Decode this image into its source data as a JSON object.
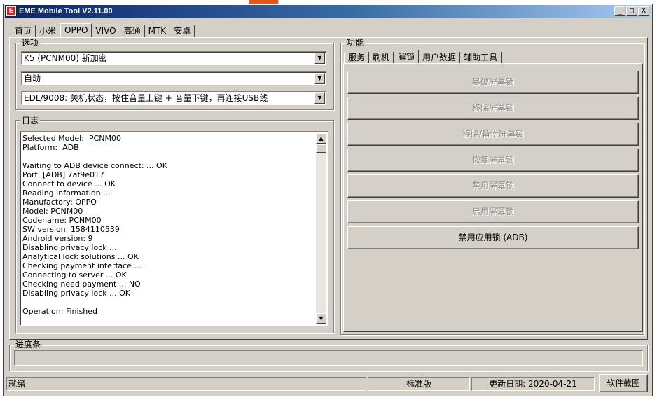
{
  "window": {
    "title": "EME Mobile Tool V2.11.00",
    "icon": "eme-logo-icon"
  },
  "title_buttons": [
    "_",
    "□",
    "X"
  ],
  "top_tabs": [
    "首页",
    "小米",
    "OPPO",
    "VIVO",
    "高通",
    "MTK",
    "安卓"
  ],
  "active_top_tab": "OPPO",
  "options": {
    "title": "选项",
    "model": "K5 (PCNM00) 新加密",
    "mode": "自动",
    "connection": "EDL/9008: 关机状态，按住音量上键 + 音量下键，再连接USB线"
  },
  "log": {
    "title": "日志",
    "text": "Selected Model:  PCNM00\nPlatform:  ADB\n\nWaiting to ADB device connect: ... OK\nPort: [ADB] 7af9e017\nConnect to device ... OK\nReading information ...\nManufactory: OPPO\nModel: PCNM00\nCodename: PCNM00\nSW version: 1584110539\nAndroid version: 9\nDisabling privacy lock ...\nAnalytical lock solutions ... OK\nChecking payment interface ...\nConnecting to server ... OK\nChecking need payment ... NO\nDisabling privacy lock ... OK\n\nOperation: Finished"
  },
  "functions": {
    "title": "功能",
    "tabs": [
      "服务",
      "刷机",
      "解锁",
      "用户数据",
      "辅助工具"
    ],
    "active_tab": "解锁",
    "buttons": [
      {
        "label": "暴破屏幕锁",
        "enabled": false
      },
      {
        "label": "移除屏幕锁",
        "enabled": false
      },
      {
        "label": "移除/备份屏幕锁",
        "enabled": false
      },
      {
        "label": "恢复屏幕锁",
        "enabled": false
      },
      {
        "label": "禁用屏幕锁",
        "enabled": false
      },
      {
        "label": "启用屏幕锁",
        "enabled": false
      },
      {
        "label": "禁用应用锁 (ADB)",
        "enabled": true
      }
    ]
  },
  "progress": {
    "title": "进度条",
    "value": 0
  },
  "status": {
    "state": "就绪",
    "edition": "标准版",
    "update_date": "更新日期: 2020-04-21",
    "screenshot_button": "软件截图"
  }
}
